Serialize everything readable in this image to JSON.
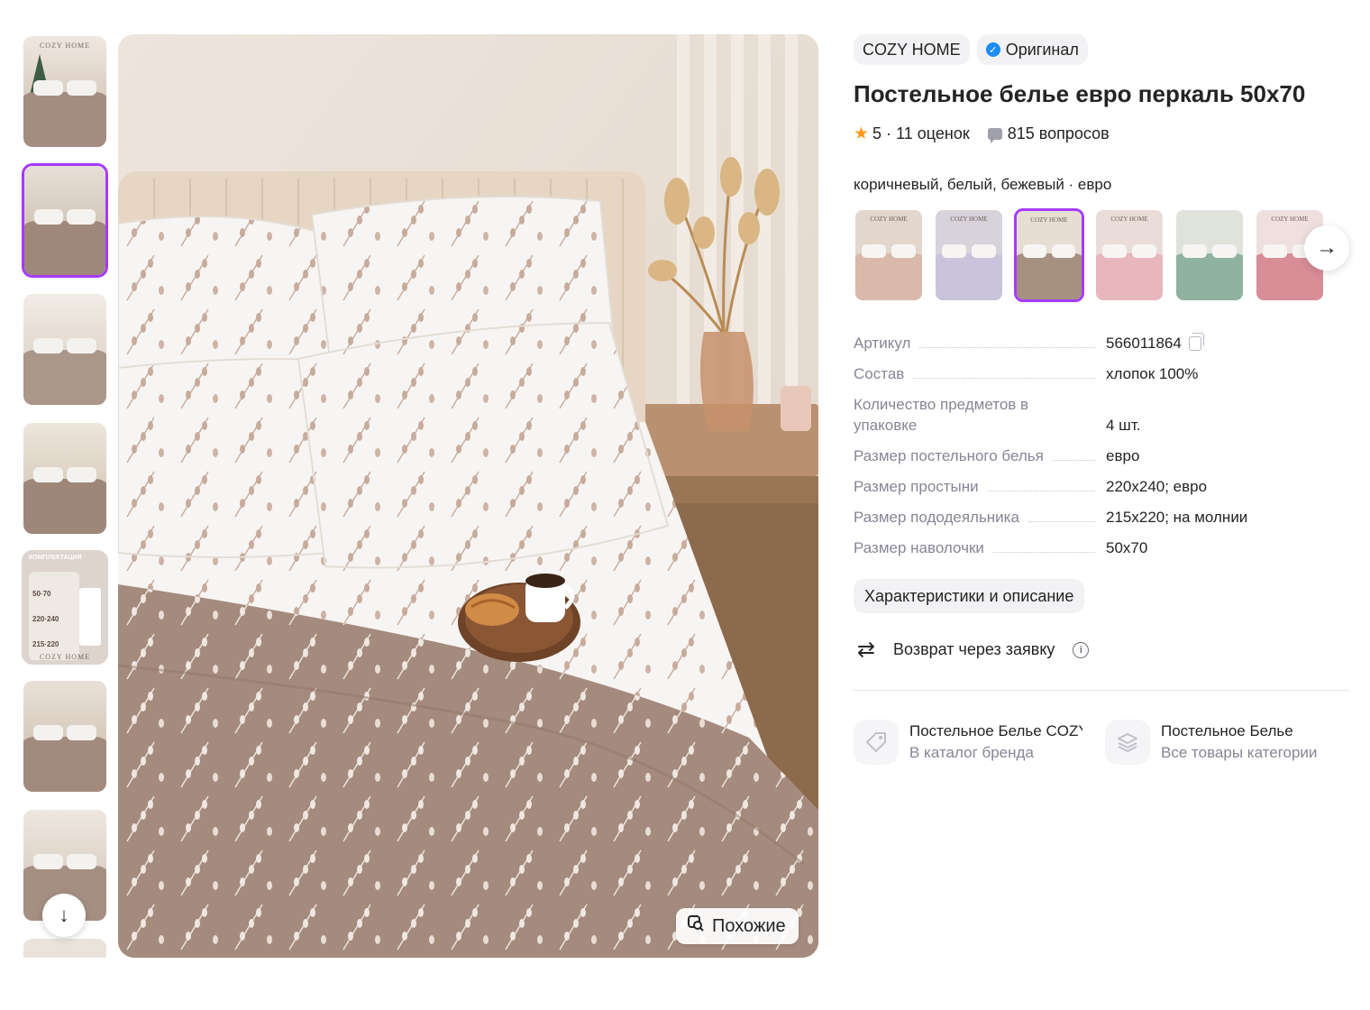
{
  "gallery": {
    "thumbnails": [
      {
        "kind": "xmas",
        "text": "COZY HOME",
        "active": false
      },
      {
        "kind": "bed",
        "active": true
      },
      {
        "kind": "bed",
        "active": false
      },
      {
        "kind": "bed",
        "active": false
      },
      {
        "kind": "infographic",
        "header": "КОМПЛЕКТАЦИЯ",
        "values": [
          "50·70",
          "220·240",
          "215·220"
        ],
        "footer": "COZY HOME",
        "active": false
      },
      {
        "kind": "bed",
        "active": false
      },
      {
        "kind": "bed",
        "active": false
      }
    ],
    "similar_label": "Похожие"
  },
  "product": {
    "brand": "COZY HOME",
    "badge": "Оригинал",
    "title": "Постельное белье евро перкаль 50х70",
    "rating": "5",
    "reviews": "11 оценок",
    "questions": "815 вопросов",
    "variant_label": "коричневый, белый, бежевый · евро",
    "variants": [
      {
        "wall": "#e3d6cc",
        "bed": "#d9b9a9",
        "text": "COZY HOME",
        "active": false
      },
      {
        "wall": "#d8d2db",
        "bed": "#c9c3dc",
        "text": "COZY HOME",
        "active": false
      },
      {
        "wall": "#e6ddd3",
        "bed": "#a6907f",
        "text": "COZY HOME",
        "active": true
      },
      {
        "wall": "#eadcd8",
        "bed": "#e8b6bd",
        "text": "COZY HOME",
        "active": false
      },
      {
        "wall": "#dfe3dc",
        "bed": "#8fb3a0",
        "text": "",
        "active": false
      },
      {
        "wall": "#efdfdf",
        "bed": "#d88d97",
        "text": "COZY HOME",
        "active": false
      }
    ]
  },
  "specs": [
    {
      "name": "Артикул",
      "value": "566011864"
    },
    {
      "name": "Состав",
      "value": "хлопок 100%"
    },
    {
      "name": "Количество предметов в упаковке",
      "value": "4 шт."
    },
    {
      "name": "Размер постельного белья",
      "value": "евро"
    },
    {
      "name": "Размер простыни",
      "value": "220х240; евро"
    },
    {
      "name": "Размер пододеяльника",
      "value": "215х220; на молнии"
    },
    {
      "name": "Размер наволочки",
      "value": "50х70"
    }
  ],
  "description_button": "Характеристики и описание",
  "return_text": "Возврат через заявку",
  "links": [
    {
      "title": "Постельное Белье COZY HOME",
      "subtitle": "В каталог бренда"
    },
    {
      "title": "Постельное Белье",
      "subtitle": "Все товары категории"
    }
  ],
  "icons": {
    "down": "arrow-down-icon",
    "next": "arrow-right-icon",
    "copy": "copy-icon",
    "return": "return-icon",
    "info": "info-icon",
    "tag": "tag-icon",
    "layers": "layers-icon",
    "similar": "similar-search-icon"
  },
  "colors": {
    "accent": "#a73afd",
    "star": "#ff9b1b",
    "verified": "#1e8df3",
    "muted": "#868695"
  }
}
